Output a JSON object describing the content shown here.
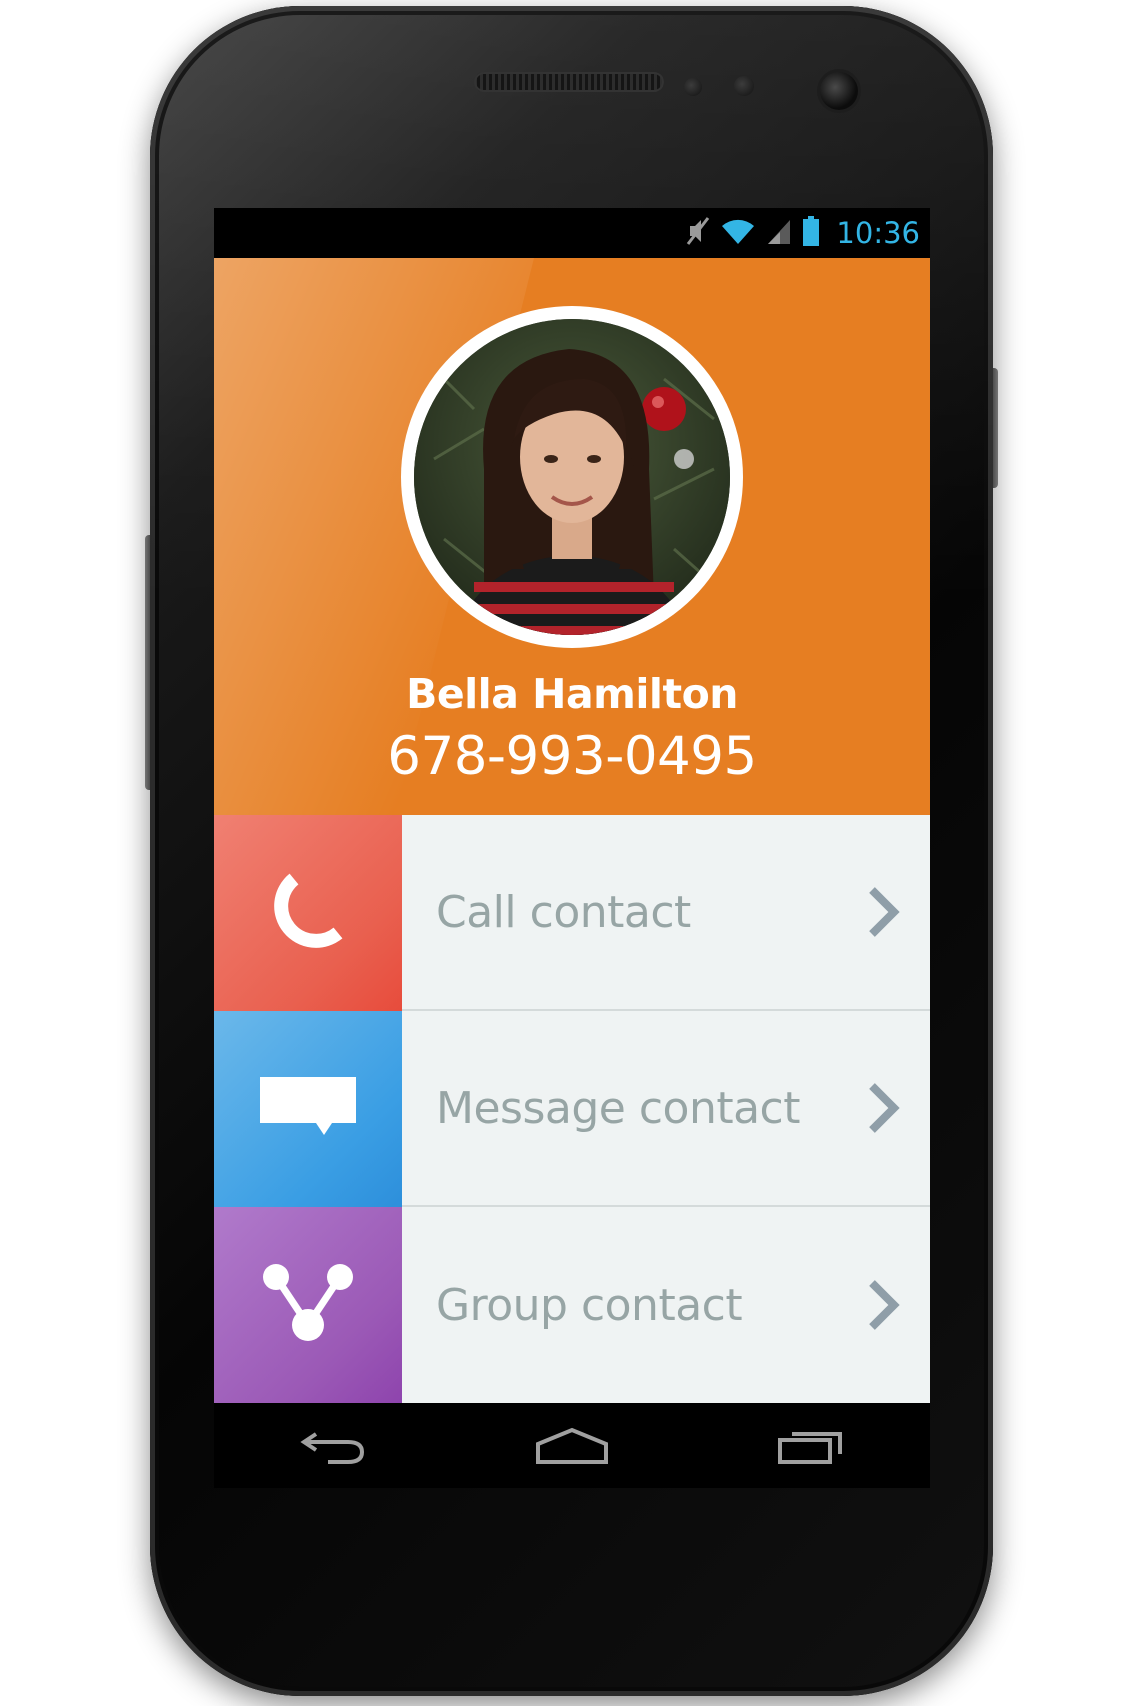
{
  "status_bar": {
    "time": "10:36",
    "icons": [
      "mute-icon",
      "wifi-icon",
      "signal-icon",
      "battery-icon"
    ],
    "time_color": "#33b5e5"
  },
  "contact": {
    "name": "Bella Hamilton",
    "phone": "678-993-0495",
    "header_color": "#e67e22"
  },
  "actions": [
    {
      "label": "Call contact",
      "icon": "phone-icon",
      "color": "#e8604c"
    },
    {
      "label": "Message contact",
      "icon": "message-icon",
      "color": "#3a9ee4"
    },
    {
      "label": "Group contact",
      "icon": "group-icon",
      "color": "#9b59b6"
    }
  ],
  "nav_bar": {
    "buttons": [
      "back-icon",
      "home-icon",
      "recent-apps-icon"
    ]
  }
}
